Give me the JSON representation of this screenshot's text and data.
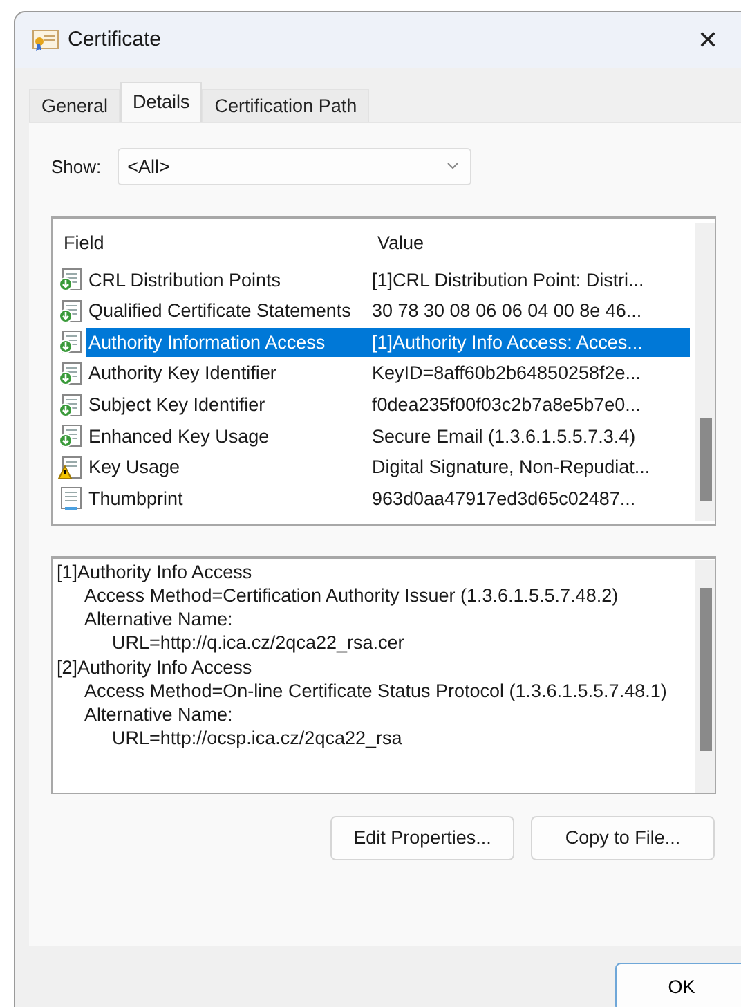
{
  "window": {
    "title": "Certificate",
    "close": "✕"
  },
  "tabs": [
    {
      "label": "General",
      "selected": false
    },
    {
      "label": "Details",
      "selected": true
    },
    {
      "label": "Certification Path",
      "selected": false
    }
  ],
  "show": {
    "label": "Show:",
    "value": "<All>"
  },
  "fields": {
    "columns": [
      "Field",
      "Value"
    ],
    "rows": [
      {
        "kind": "extension",
        "field": "CRL Distribution Points",
        "value": "[1]CRL Distribution Point: Distri...",
        "selected": false
      },
      {
        "kind": "extension",
        "field": "Qualified Certificate Statements",
        "value": "30 78 30 08 06 06 04 00 8e 46...",
        "selected": false
      },
      {
        "kind": "extension",
        "field": "Authority Information Access",
        "value": "[1]Authority Info Access: Acces...",
        "selected": true
      },
      {
        "kind": "extension",
        "field": "Authority Key Identifier",
        "value": "KeyID=8aff60b2b64850258f2e...",
        "selected": false
      },
      {
        "kind": "extension",
        "field": "Subject Key Identifier",
        "value": "f0dea235f00f03c2b7a8e5b7e0...",
        "selected": false
      },
      {
        "kind": "extension",
        "field": "Enhanced Key Usage",
        "value": "Secure Email (1.3.6.1.5.5.7.3.4)",
        "selected": false
      },
      {
        "kind": "critical",
        "field": "Key Usage",
        "value": "Digital Signature, Non-Repudiat...",
        "selected": false
      },
      {
        "kind": "property",
        "field": "Thumbprint",
        "value": "963d0aa47917ed3d65c02487...",
        "selected": false
      }
    ]
  },
  "detail": [
    {
      "text": "[1]Authority Info Access",
      "children": [
        {
          "text": "Access Method=Certification Authority Issuer (1.3.6.1.5.5.7.48.2)"
        },
        {
          "text": "Alternative Name:",
          "children": [
            {
              "text": "URL=http://q.ica.cz/2qca22_rsa.cer"
            }
          ]
        }
      ]
    },
    {
      "text": "[2]Authority Info Access",
      "children": [
        {
          "text": "Access Method=On-line Certificate Status Protocol (1.3.6.1.5.5.7.48.1)"
        },
        {
          "text": "Alternative Name:",
          "children": [
            {
              "text": "URL=http://ocsp.ica.cz/2qca22_rsa"
            }
          ]
        }
      ]
    }
  ],
  "buttons": [
    "Edit Properties...",
    "Copy to File..."
  ],
  "ok": "OK"
}
